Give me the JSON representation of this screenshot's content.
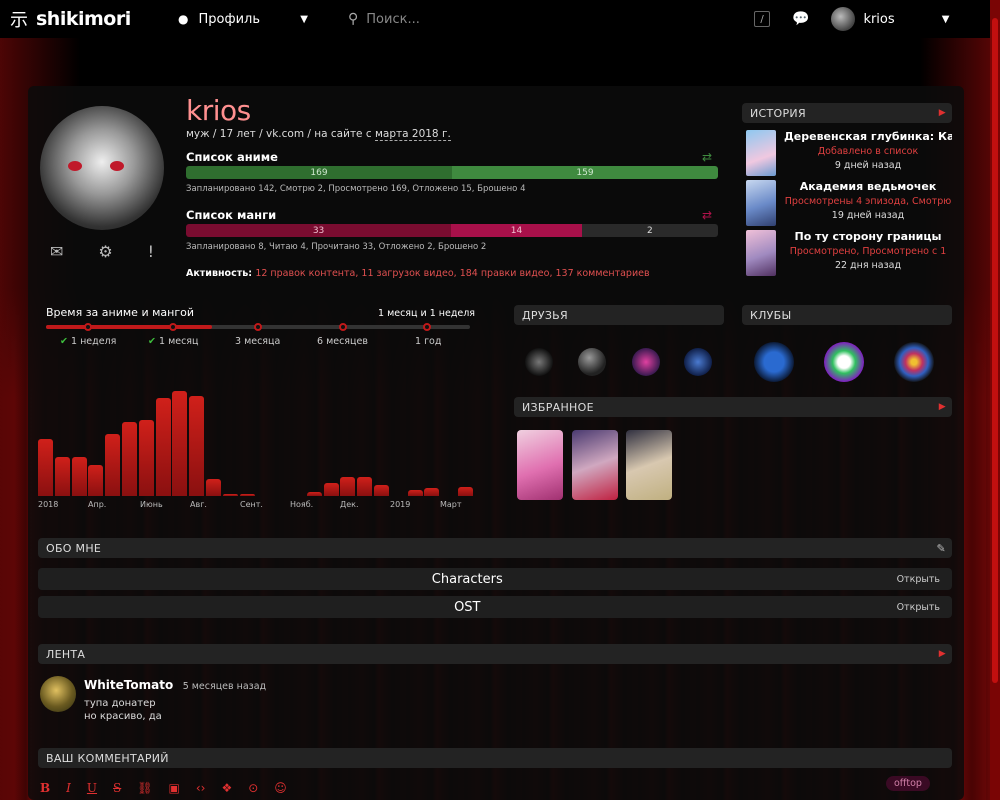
{
  "header": {
    "logo_text": "shikimori",
    "profile_menu": "Профиль",
    "search_placeholder": "Поиск...",
    "slash_key": "/",
    "user_name": "krios"
  },
  "profile": {
    "nick": "krios",
    "meta_prefix": "муж / 17 лет / vk.com / на сайте с ",
    "meta_date": "марта 2018 г."
  },
  "anime_list": {
    "title": "Список аниме",
    "completed": 169,
    "completed_fraction": 0.5,
    "other": 159,
    "note": "Запланировано 142, Смотрю 2, Просмотрено 169, Отложено 15, Брошено 4"
  },
  "manga_list": {
    "title": "Список манги",
    "v1": 33,
    "v2": 14,
    "v3": 2,
    "note": "Запланировано 8, Читаю 4, Прочитано 33, Отложено 2, Брошено 2"
  },
  "activity": {
    "label": "Активность:",
    "links": "12 правок контента, 11 загрузок видео, 184 правки видео, 137 комментариев"
  },
  "history": {
    "title": "ИСТОРИЯ",
    "items": [
      {
        "name": "Деревенская глубинка: Ка...",
        "sub": "Добавлено в список",
        "time": "9 дней назад"
      },
      {
        "name": "Академия ведьмочек",
        "sub": "Просмотрены 4 эпизода, Смотрю",
        "time": "19 дней назад"
      },
      {
        "name": "По ту сторону границы",
        "sub": "Просмотрено, Просмотрено с 1",
        "time": "22 дня назад"
      }
    ]
  },
  "time_chart": {
    "title": "Время за аниме и мангой",
    "range": "1 месяц и 1 неделя",
    "periods": [
      "1 неделя",
      "1 месяц",
      "3 месяца",
      "6 месяцев",
      "1 год"
    ],
    "check": "✔"
  },
  "chart_data": {
    "type": "bar",
    "title": "Время за аниме и мангой",
    "tick_labels": [
      "2018",
      "Апр.",
      "Июнь",
      "Авг.",
      "Сент.",
      "Нояб.",
      "Дек.",
      "2019",
      "Март"
    ],
    "values": [
      57,
      39,
      39,
      31,
      62,
      74,
      76,
      98,
      105,
      100,
      17,
      2,
      2,
      0,
      0,
      0,
      4,
      13,
      19,
      19,
      11,
      0,
      6,
      8,
      0,
      9
    ]
  },
  "friends": {
    "title": "ДРУЗЬЯ"
  },
  "clubs": {
    "title": "КЛУБЫ"
  },
  "favorites": {
    "title": "ИЗБРАННОЕ"
  },
  "about": {
    "title": "ОБО МНЕ",
    "rows": [
      {
        "label": "Characters",
        "action": "Открыть"
      },
      {
        "label": "OST",
        "action": "Открыть"
      }
    ]
  },
  "feed": {
    "title": "ЛЕНТА",
    "user": "WhiteTomato",
    "time": "5 месяцев назад",
    "line1": "тупа донатер",
    "line2": "но красиво, да"
  },
  "comment": {
    "title": "ВАШ КОММЕНТАРИЙ",
    "tools": {
      "bold": "B",
      "italic": "I",
      "underline": "U",
      "strike": "S"
    },
    "offtop": "offtop"
  },
  "colors": {
    "accent": "#c0191a",
    "anime_bar": "#3f8a3f",
    "manga_bar": "#b0124a",
    "link": "#e05050"
  }
}
